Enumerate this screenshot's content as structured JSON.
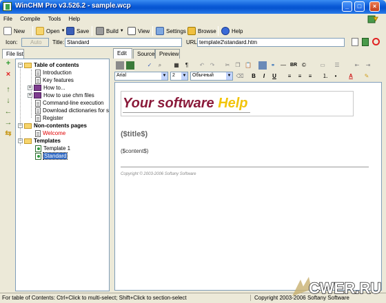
{
  "window": {
    "title": "WinCHM Pro v3.526.2 - sample.wcp"
  },
  "menu": [
    "File",
    "Compile",
    "Tools",
    "Help"
  ],
  "toolbar": {
    "new_label": "New",
    "open_label": "Open",
    "save_label": "Save",
    "build_label": "Build",
    "view_label": "View",
    "settings_label": "Settings",
    "browse_label": "Browse",
    "help_label": "Help"
  },
  "props": {
    "icon_label": "Icon:",
    "icon_value": "Auto",
    "title_label": "Title:",
    "title_value": "Standard",
    "url_label": "URL:",
    "url_value": "template2\\standard.htm"
  },
  "file_list_tab": "File list",
  "tree": {
    "toc_label": "Table of contents",
    "toc_items": [
      "Introduction",
      "Key features",
      "How to...",
      "How to use chm files",
      "Command-line execution",
      "Download dictionaries for sp",
      "Register"
    ],
    "noncontents_label": "Non-contents pages",
    "noncontents_items": [
      "Welcome"
    ],
    "templates_label": "Templates",
    "templates_items": [
      "Template 1",
      "Standard"
    ]
  },
  "editor_tabs": [
    "Edit",
    "Source",
    "Preview"
  ],
  "format": {
    "font": "Arial",
    "size": "2",
    "style": "Обычный"
  },
  "document": {
    "banner_part1": "Your software ",
    "banner_part2": "Help",
    "title_placeholder": "($title$)",
    "content_placeholder": "($content$)",
    "copyright": "Copyright © 2003-2006 Softany Software"
  },
  "status": {
    "left": "For table of Contents: Ctrl+Click to multi-select; Shift+Click to section-select",
    "right": "Copyright 2003-2006 Softany Software"
  },
  "watermark_text": "CWER.RU",
  "colors": {
    "title_bar": "#0a5ad6",
    "banner_red": "#8a1a3a",
    "banner_yellow": "#f2c40a",
    "selection": "#316ac5"
  }
}
